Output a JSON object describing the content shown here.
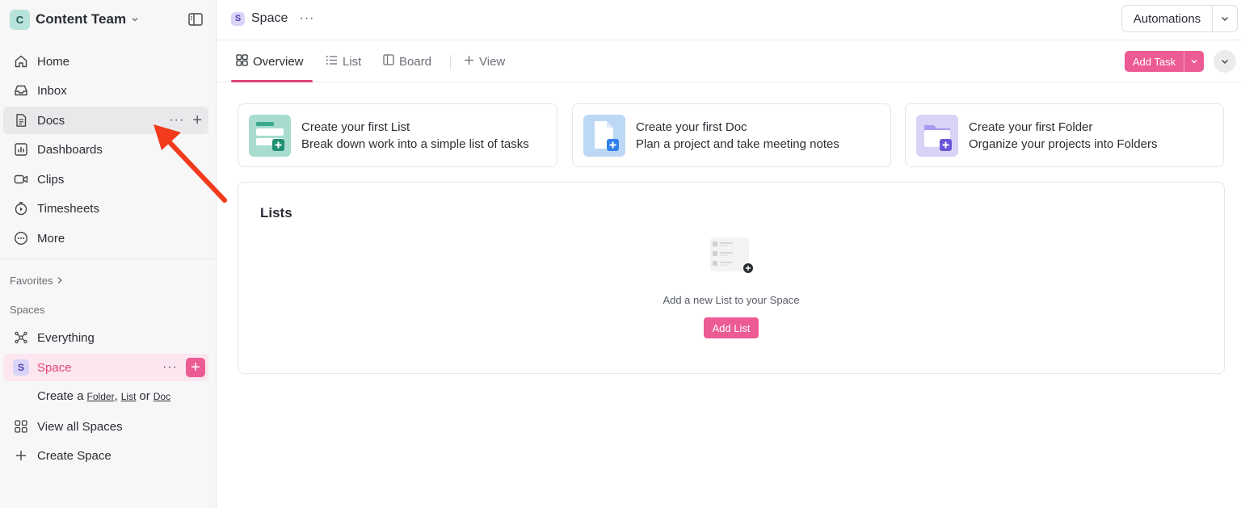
{
  "workspace": {
    "initial": "C",
    "name": "Content Team"
  },
  "sidebar": {
    "nav": [
      {
        "label": "Home",
        "icon": "home-icon"
      },
      {
        "label": "Inbox",
        "icon": "inbox-icon"
      },
      {
        "label": "Docs",
        "icon": "doc-icon"
      },
      {
        "label": "Dashboards",
        "icon": "dashboard-icon"
      },
      {
        "label": "Clips",
        "icon": "video-icon"
      },
      {
        "label": "Timesheets",
        "icon": "timer-icon"
      },
      {
        "label": "More",
        "icon": "more-circle-icon"
      }
    ],
    "favorites_label": "Favorites",
    "spaces_label": "Spaces",
    "everything_label": "Everything",
    "space": {
      "initial": "S",
      "label": "Space"
    },
    "create_row": {
      "prefix": "Create a",
      "folder": "Folder",
      "sep1": ",",
      "list": "List",
      "or": "or",
      "doc": "Doc"
    },
    "view_all_spaces": "View all Spaces",
    "create_space": "Create Space"
  },
  "header": {
    "space_initial": "S",
    "title": "Space",
    "automations_label": "Automations"
  },
  "views": {
    "tabs": [
      {
        "label": "Overview",
        "icon": "overview-icon"
      },
      {
        "label": "List",
        "icon": "list-icon"
      },
      {
        "label": "Board",
        "icon": "board-icon"
      }
    ],
    "add_view_label": "View",
    "add_task_label": "Add Task"
  },
  "cards": [
    {
      "title": "Create your first List",
      "subtitle": "Break down work into a simple list of tasks",
      "icon": "list-thumb-icon",
      "color": "#a8dccf"
    },
    {
      "title": "Create your first Doc",
      "subtitle": "Plan a project and take meeting notes",
      "icon": "doc-thumb-icon",
      "color": "#bcd8f5"
    },
    {
      "title": "Create your first Folder",
      "subtitle": "Organize your projects into Folders",
      "icon": "folder-thumb-icon",
      "color": "#d9d3f7"
    }
  ],
  "lists_section": {
    "title": "Lists",
    "empty_text": "Add a new List to your Space",
    "add_button": "Add List"
  },
  "colors": {
    "accent": "#ec5b93",
    "active_bg": "#fce6ef",
    "sidebar_bg": "#f7f7f8",
    "arrow": "#f23a1d"
  }
}
